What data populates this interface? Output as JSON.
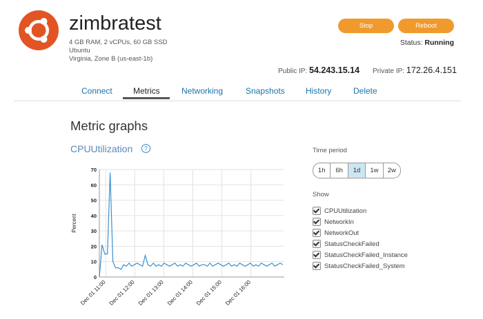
{
  "instance": {
    "name": "zimbratest",
    "specs": "4 GB RAM, 2 vCPUs, 60 GB SSD",
    "os": "Ubuntu",
    "location": "Virginia, Zone B (us-east-1b)",
    "logo_icon": "ubuntu-logo-icon",
    "logo_color": "#e35424"
  },
  "actions": {
    "stop_label": "Stop",
    "reboot_label": "Reboot",
    "button_color": "#f09a2d"
  },
  "status": {
    "label": "Status:",
    "value": "Running"
  },
  "network": {
    "public_label": "Public IP:",
    "public_ip": "54.243.15.14",
    "private_label": "Private IP:",
    "private_ip": "172.26.4.151"
  },
  "tabs": [
    {
      "label": "Connect"
    },
    {
      "label": "Metrics",
      "active": true
    },
    {
      "label": "Networking"
    },
    {
      "label": "Snapshots"
    },
    {
      "label": "History"
    },
    {
      "label": "Delete"
    }
  ],
  "page": {
    "title": "Metric graphs",
    "graph_title": "CPUUtilization",
    "help_symbol": "?"
  },
  "time_period": {
    "label": "Time period",
    "options": [
      "1h",
      "6h",
      "1d",
      "1w",
      "2w"
    ],
    "selected": "1d"
  },
  "show": {
    "label": "Show",
    "items": [
      {
        "label": "CPUUtilization",
        "checked": true
      },
      {
        "label": "NetworkIn",
        "checked": true
      },
      {
        "label": "NetworkOut",
        "checked": true
      },
      {
        "label": "StatusCheckFailed",
        "checked": true
      },
      {
        "label": "StatusCheckFailed_Instance",
        "checked": true
      },
      {
        "label": "StatusCheckFailed_System",
        "checked": true
      }
    ]
  },
  "chart_data": {
    "type": "line",
    "ylabel": "Percent",
    "ylim": [
      0,
      70
    ],
    "yticks": [
      0,
      10,
      20,
      30,
      40,
      50,
      60,
      70
    ],
    "x_ticklabels": [
      "Dec 01 11:00",
      "Dec 01 12:00",
      "Dec 01 13:00",
      "Dec 01 14:00",
      "Dec 01 15:00",
      "Dec 01 16:00"
    ],
    "x_tick_positions": [
      1,
      2,
      3,
      4,
      5,
      6
    ],
    "xlim": [
      0.78,
      7.15
    ],
    "grid": true,
    "line_color": "#3a8fd0",
    "series": [
      {
        "values": [
          0,
          21,
          15,
          15,
          68,
          10,
          6,
          6,
          5,
          8,
          7,
          9,
          7,
          8,
          9,
          8,
          7,
          14,
          8,
          7,
          9,
          7,
          8,
          7,
          9,
          8,
          7,
          8,
          9,
          7,
          8,
          7,
          9,
          8,
          7,
          8,
          9,
          7,
          8,
          8,
          7,
          9,
          7,
          8,
          9,
          8,
          7,
          8,
          9,
          7,
          8,
          7,
          9,
          8,
          7,
          8,
          9,
          7,
          8,
          7,
          9,
          8,
          7,
          8,
          9,
          7,
          8,
          9,
          8
        ],
        "x_start": 0.78,
        "x_end": 7.1
      }
    ]
  }
}
